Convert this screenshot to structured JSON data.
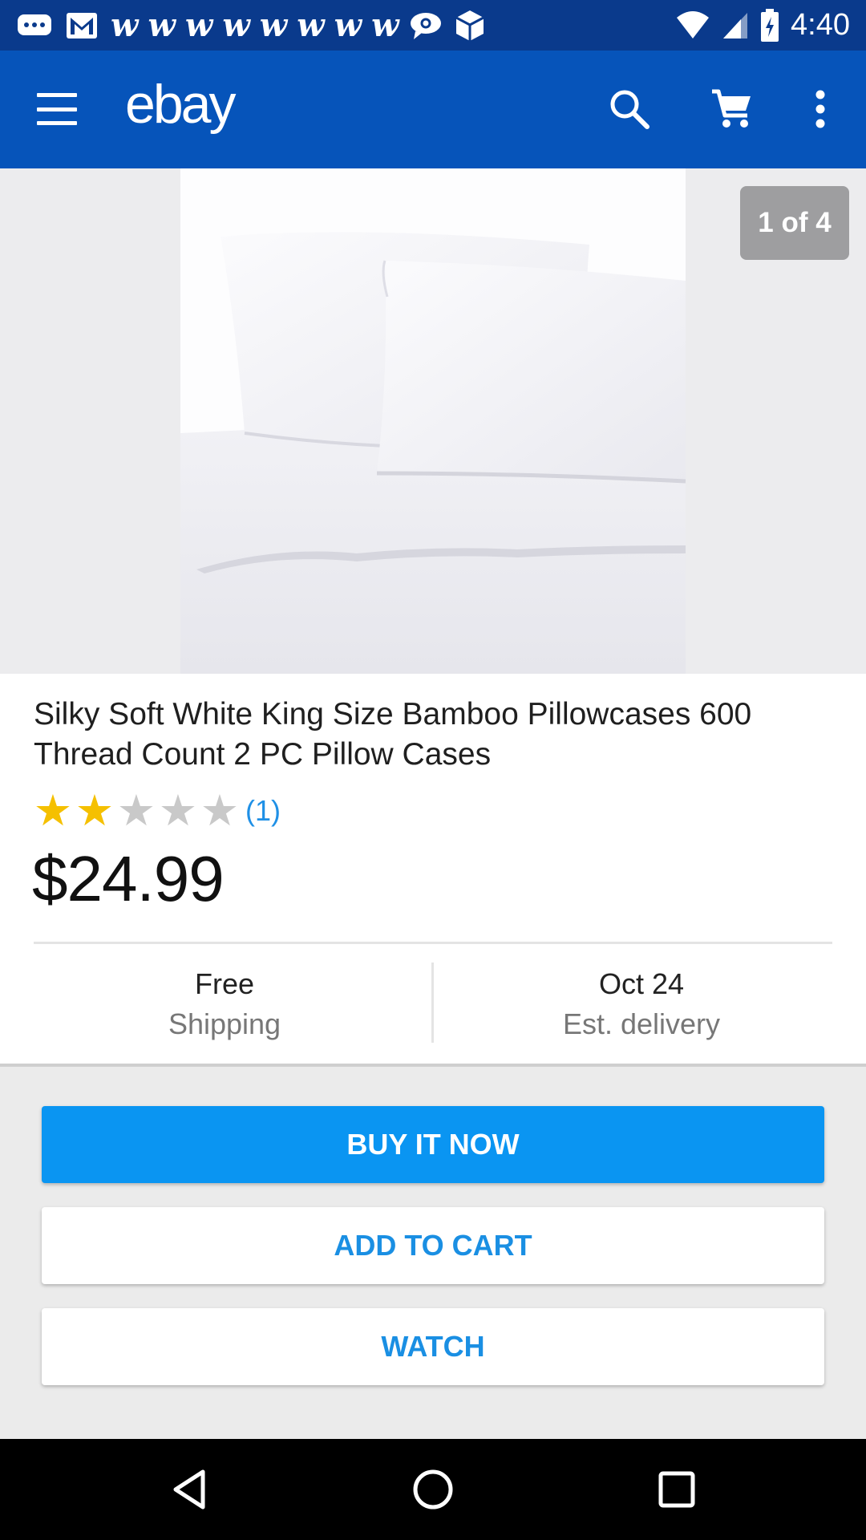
{
  "status_bar": {
    "time": "4:40",
    "notification_icons": [
      "chat-bubble-icon",
      "gmail-icon",
      "w-icon",
      "w-icon",
      "w-icon",
      "w-icon",
      "w-icon",
      "w-icon",
      "w-icon",
      "w-icon",
      "message-icon",
      "box-icon"
    ],
    "w_glyph": "w",
    "system_icons": [
      "wifi-icon",
      "signal-icon",
      "battery-charging-icon"
    ]
  },
  "app_bar": {
    "logo": "ebay",
    "icons": [
      "menu-icon",
      "search-icon",
      "cart-icon",
      "more-vert-icon"
    ],
    "color": "#0654ba"
  },
  "gallery": {
    "counter": "1 of 4"
  },
  "listing": {
    "title": "Silky Soft White King Size Bamboo Pillowcases 600 Thread Count 2 PC Pillow Cases",
    "rating_stars": 2,
    "rating_max": 5,
    "review_count": "(1)",
    "price": "$24.99",
    "shipping": {
      "value": "Free",
      "label": "Shipping"
    },
    "delivery": {
      "value": "Oct 24",
      "label": "Est. delivery"
    }
  },
  "actions": {
    "buy_now": "BUY IT NOW",
    "add_to_cart": "ADD TO CART",
    "watch": "WATCH"
  },
  "colors": {
    "status_bar": "#0a3a8c",
    "primary_button": "#0a95f2",
    "link": "#1a8fe3",
    "star": "#f5c000"
  }
}
